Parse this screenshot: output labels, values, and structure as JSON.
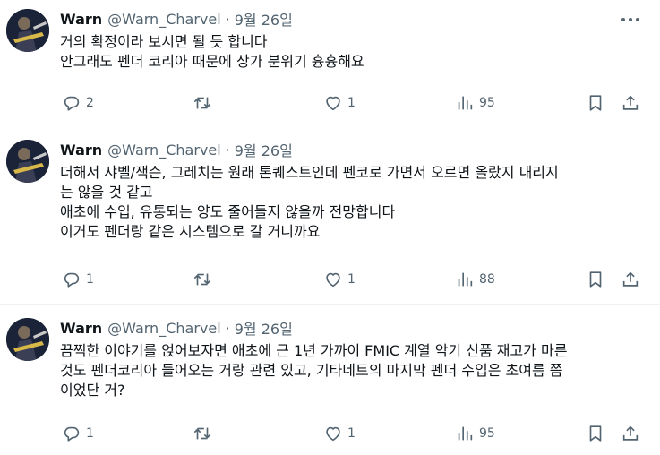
{
  "tweets": [
    {
      "name": "Warn",
      "handle": "@Warn_Charvel",
      "separator": "·",
      "date": "9월 26일",
      "lines": [
        "거의 확정이라 보시면 될 듯 합니다",
        "안그래도 펜더 코리아 때문에 상가 분위기 흉흉해요"
      ],
      "replies": "2",
      "views": "95"
    },
    {
      "name": "Warn",
      "handle": "@Warn_Charvel",
      "separator": "·",
      "date": "9월 26일",
      "lines": [
        "더해서 샤벨/잭슨, 그레치는 원래 톤퀘스트인데 펜코로 가면서 오르면 올랐지 내리지",
        "는 않을 것 같고",
        "애초에 수입, 유통되는 양도 줄어들지 않을까 전망합니다",
        "이거도 펜더랑 같은 시스템으로 갈 거니까요"
      ],
      "replies": "1",
      "views": "88"
    },
    {
      "name": "Warn",
      "handle": "@Warn_Charvel",
      "separator": "·",
      "date": "9월 26일",
      "lines": [
        "끔찍한 이야기를 얹어보자면 애초에 근 1년 가까이 FMIC 계열 악기 신품 재고가 마른",
        "것도 펜더코리아 들어오는 거랑 관련 있고, 기타네트의 마지막 펜더 수입은 초여름 쯤",
        "이었단 거?"
      ],
      "replies": "1",
      "views": "95"
    }
  ],
  "icons": {
    "reply": "reply-icon",
    "retweet": "retweet-icon",
    "like": "heart-icon",
    "views": "views-icon",
    "bookmark": "bookmark-icon",
    "share": "share-icon",
    "more": "more-icon"
  },
  "colors": {
    "text": "#0f1419",
    "secondary": "#536471",
    "divider": "#eff3f4"
  }
}
